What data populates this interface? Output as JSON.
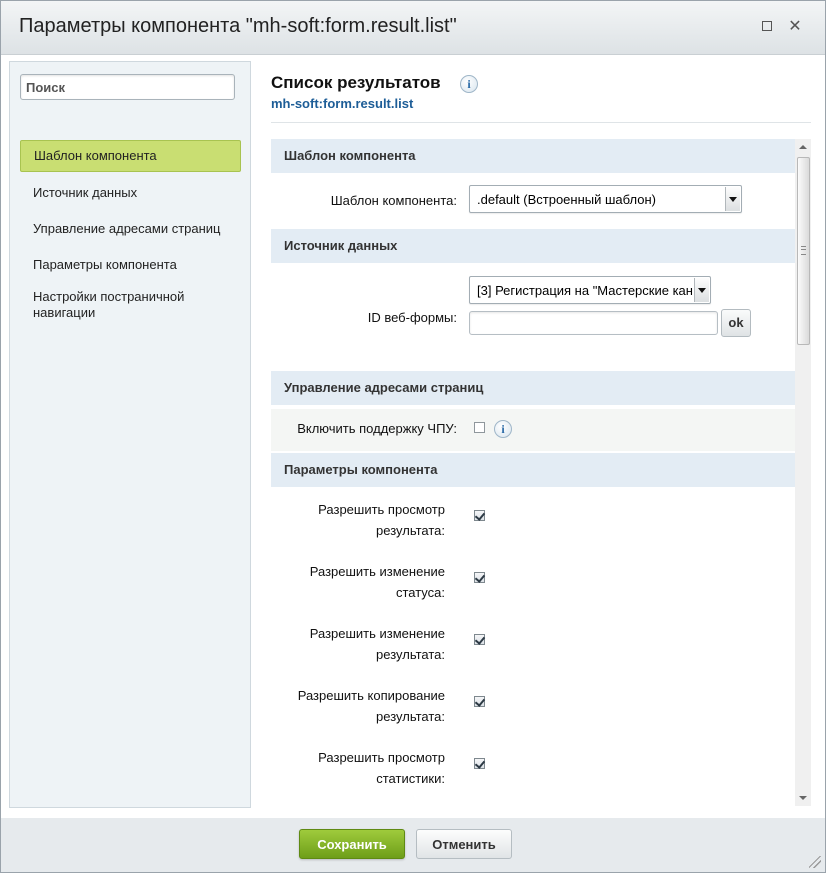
{
  "window": {
    "title": "Параметры компонента \"mh-soft:form.result.list\""
  },
  "sidebar": {
    "search_placeholder": "Поиск",
    "items": [
      {
        "label": "Шаблон компонента",
        "active": true
      },
      {
        "label": "Источник данных",
        "active": false
      },
      {
        "label": "Управление адресами страниц",
        "active": false
      },
      {
        "label": "Параметры компонента",
        "active": false
      },
      {
        "label": "Настройки постраничной навигации",
        "active": false
      }
    ]
  },
  "main": {
    "title": "Список результатов",
    "subtitle": "mh-soft:form.result.list"
  },
  "sections": {
    "template": {
      "header": "Шаблон компонента",
      "field_label": "Шаблон компонента:",
      "field_value": ".default (Встроенный шаблон)"
    },
    "data_source": {
      "header": "Источник данных",
      "field_label": "ID веб-формы:",
      "select_value": "[3] Регистрация на \"Мастерские кан",
      "input_value": "",
      "ok_label": "ok"
    },
    "urls": {
      "header": "Управление адресами страниц",
      "cpu_label": "Включить поддержку ЧПУ:",
      "cpu_checked": false
    },
    "params": {
      "header": "Параметры компонента",
      "options": [
        {
          "line1": "Разрешить просмотр",
          "line2": "результата:",
          "checked": true
        },
        {
          "line1": "Разрешить изменение",
          "line2": "статуса:",
          "checked": true
        },
        {
          "line1": "Разрешить изменение",
          "line2": "результата:",
          "checked": true
        },
        {
          "line1": "Разрешить копирование",
          "line2": "результата:",
          "checked": true
        },
        {
          "line1": "Разрешить просмотр",
          "line2": "статистики:",
          "checked": true
        }
      ]
    }
  },
  "footer": {
    "save_label": "Сохранить",
    "cancel_label": "Отменить"
  },
  "colors": {
    "active_item_bg": "#c9de72",
    "section_header_bg": "#e3ecf4",
    "save_button": "#7fae22",
    "subtitle_link": "#1d5d97"
  }
}
